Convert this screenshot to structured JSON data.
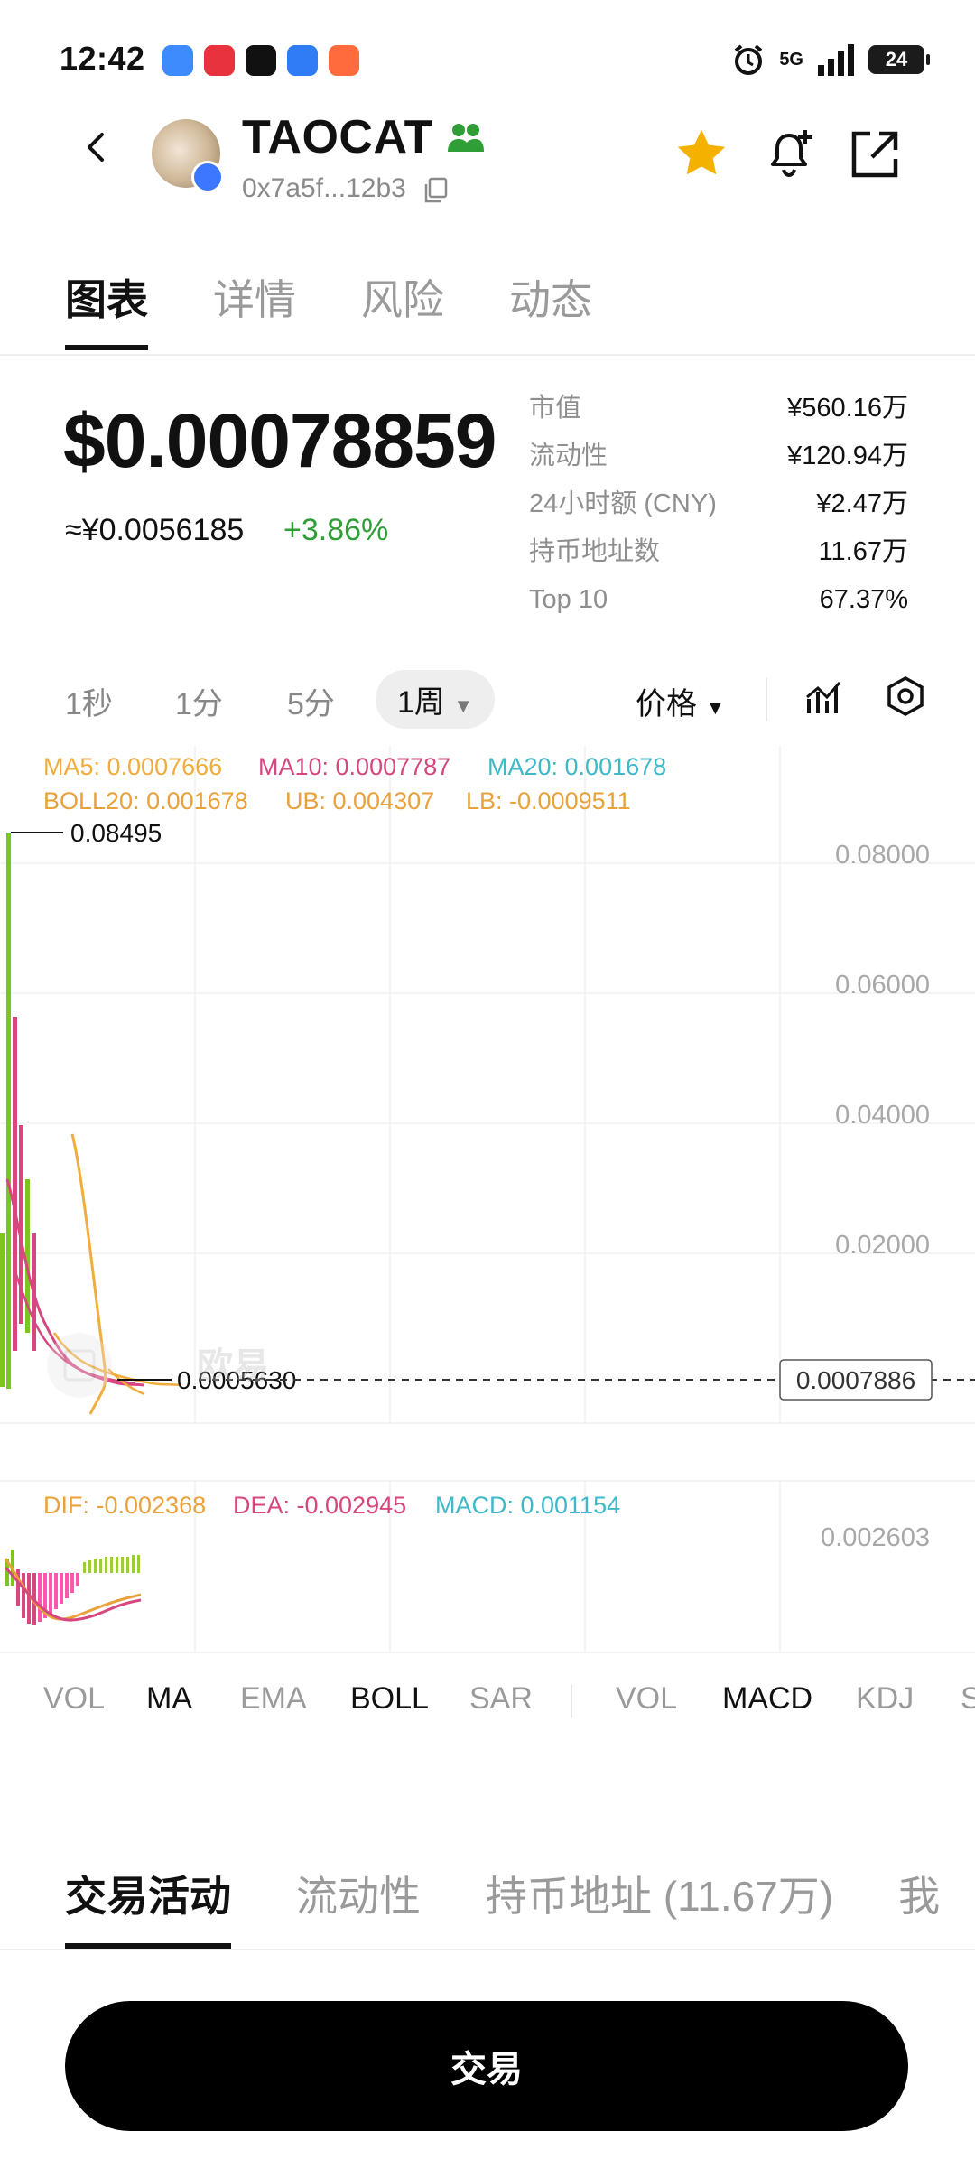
{
  "status_bar": {
    "time": "12:42",
    "network": "5G",
    "battery": "24"
  },
  "header": {
    "token_name": "TAOCAT",
    "address": "0x7a5f...12b3"
  },
  "tabs": [
    "图表",
    "详情",
    "风险",
    "动态"
  ],
  "price": {
    "usd": "$0.00078859",
    "cny": "≈¥0.0056185",
    "change": "+3.86%"
  },
  "stats": [
    {
      "label": "市值",
      "value": "¥560.16万"
    },
    {
      "label": "流动性",
      "value": "¥120.94万"
    },
    {
      "label": "24小时额 (CNY)",
      "value": "¥2.47万"
    },
    {
      "label": "持币地址数",
      "value": "11.67万"
    },
    {
      "label": "Top 10",
      "value": "67.37%"
    }
  ],
  "intervals": [
    "1秒",
    "1分",
    "5分",
    "1周"
  ],
  "selected_interval": "1周",
  "price_mode": "价格",
  "chart_legend": {
    "ma5": "MA5: 0.0007666",
    "ma10": "MA10: 0.0007787",
    "ma20": "MA20: 0.001678",
    "boll": "BOLL20: 0.001678",
    "ub": "UB: 0.004307",
    "lb": "LB: -0.0009511",
    "dif": "DIF: -0.002368",
    "dea": "DEA: -0.002945",
    "macd": "MACD: 0.001154"
  },
  "chart_data": {
    "type": "candlestick",
    "y_ticks": [
      "0.08000",
      "0.06000",
      "0.04000",
      "0.02000"
    ],
    "high_label": "0.08495",
    "low_label": "0.0005630",
    "current_price_label": "0.0007886",
    "macd_tick": "0.002603",
    "watermark": "欧易",
    "colors": {
      "up": "#7ac51f",
      "ma5": "#f0ad3c",
      "ma10": "#d6467f",
      "ma20": "#3fb8c8"
    }
  },
  "indicators_main": [
    "VOL",
    "MA",
    "EMA",
    "BOLL",
    "SAR"
  ],
  "indicators_sub": [
    "VOL",
    "MACD",
    "KDJ",
    "S"
  ],
  "bottom_tabs": [
    "交易活动",
    "流动性",
    "持币地址 (11.67万)",
    "我"
  ],
  "trade_button": "交易"
}
